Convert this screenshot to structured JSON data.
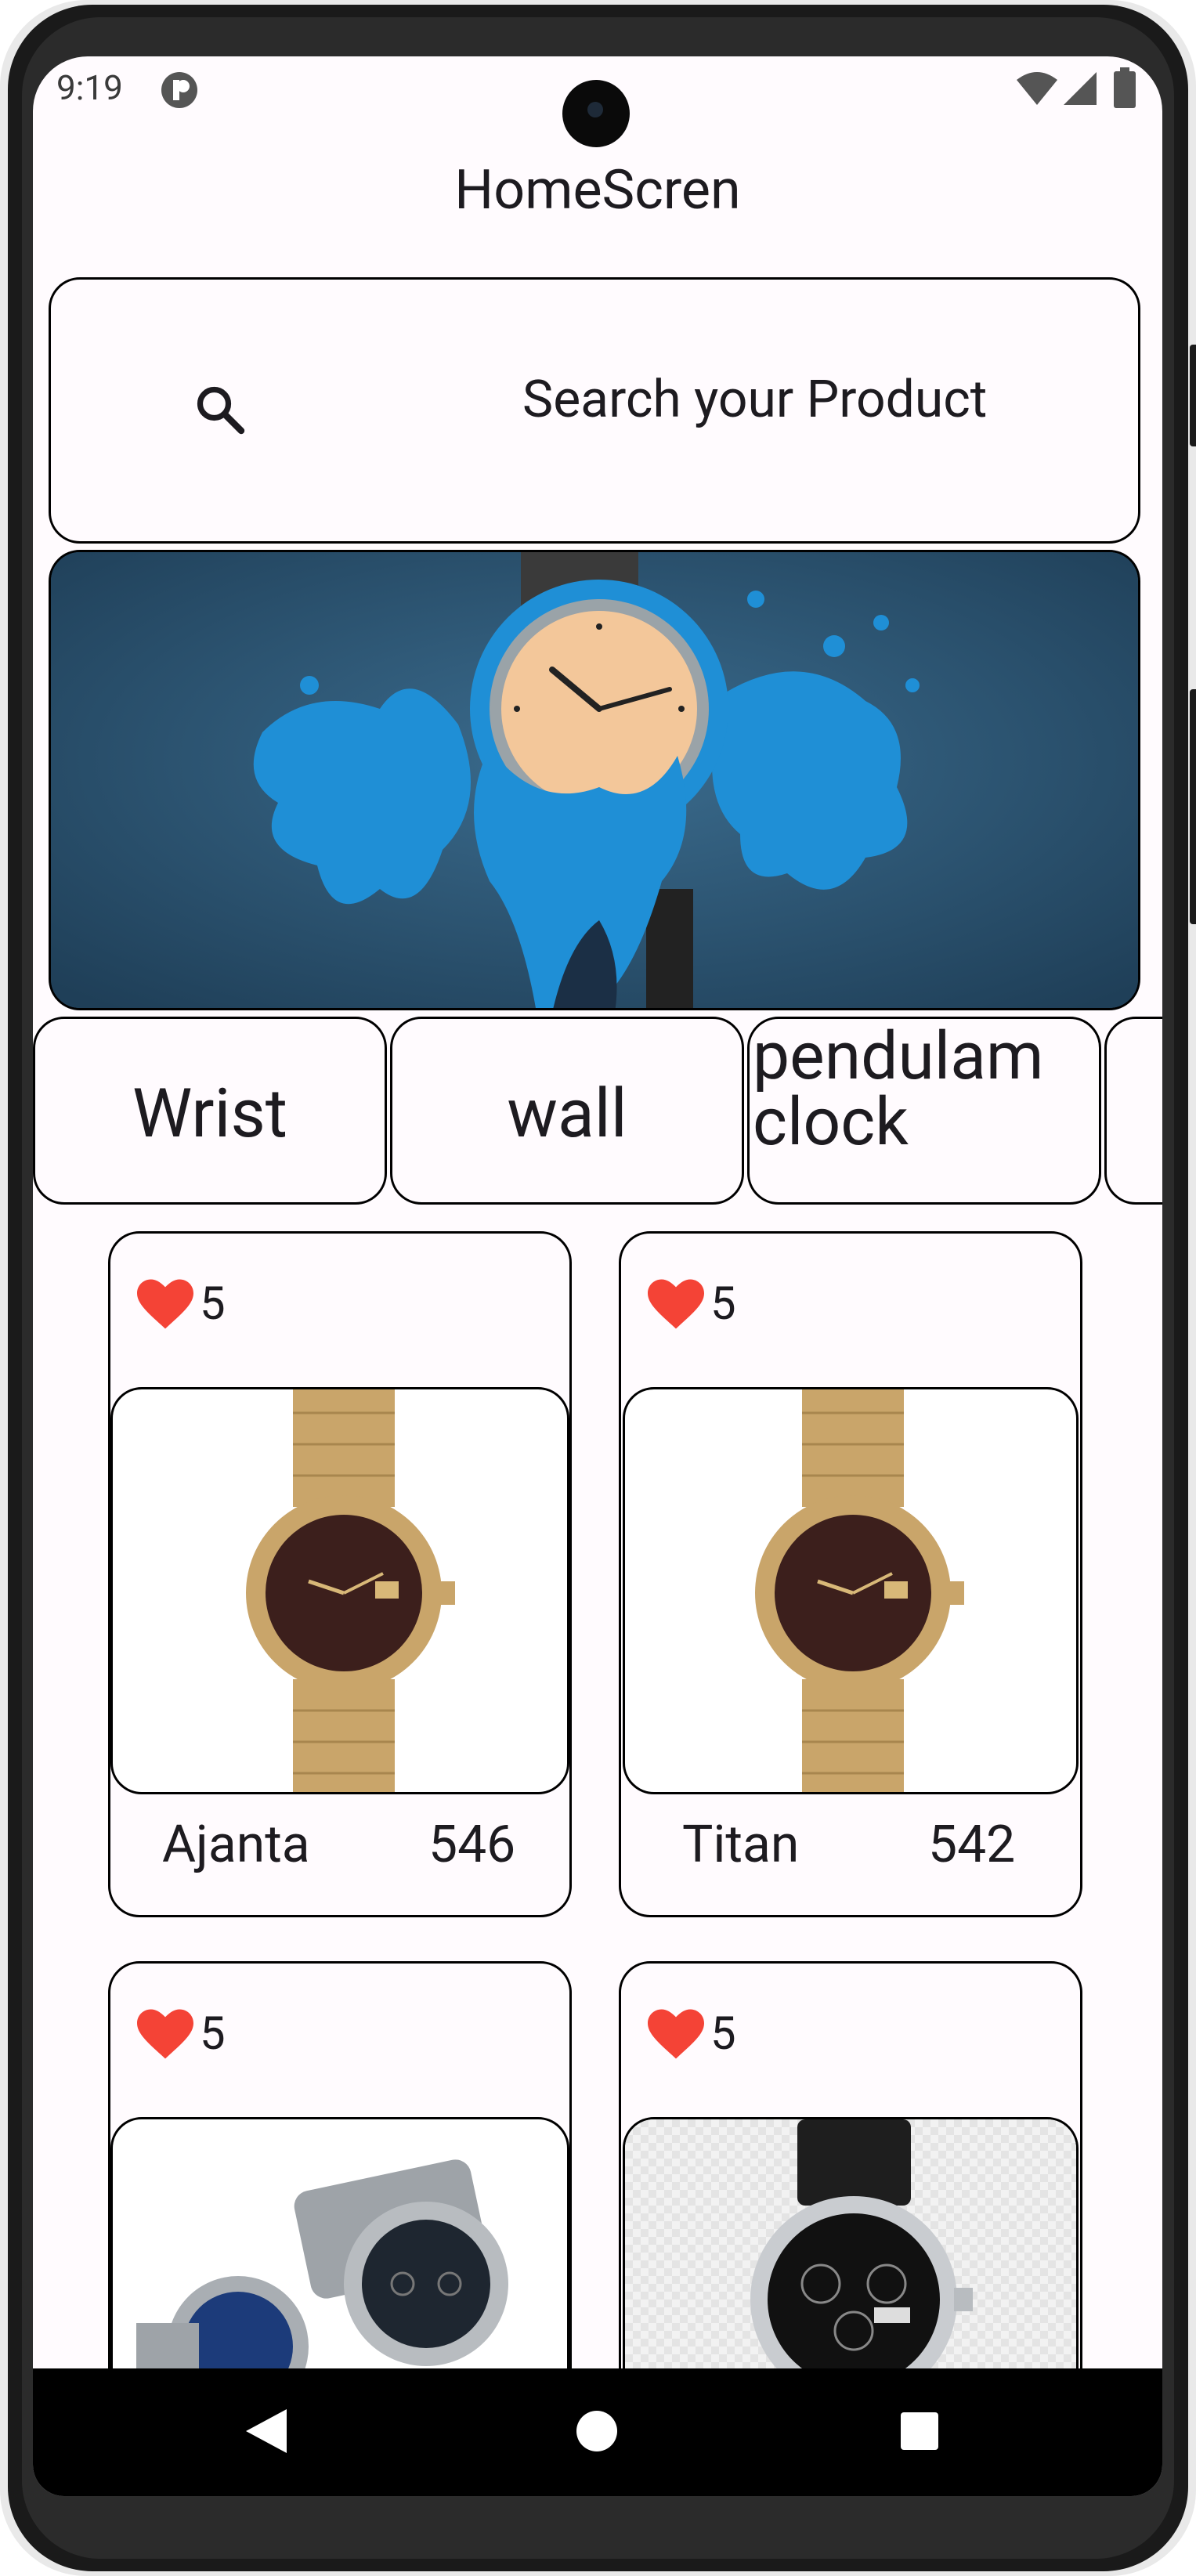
{
  "status_bar": {
    "time": "9:19"
  },
  "app": {
    "title": "HomeScren"
  },
  "search": {
    "placeholder": "Search your Product"
  },
  "categories": [
    {
      "label": "Wrist"
    },
    {
      "label": "wall"
    },
    {
      "label": "pendulam clock",
      "line1": "pendulam",
      "line2": "clock"
    }
  ],
  "products": [
    {
      "likes": "5",
      "name": "Ajanta",
      "price": "546"
    },
    {
      "likes": "5",
      "name": "Titan",
      "price": "542"
    },
    {
      "likes": "5",
      "name": "",
      "price": ""
    },
    {
      "likes": "5",
      "name": "",
      "price": ""
    }
  ],
  "colors": {
    "heart": "#f44336",
    "background": "#fffbfe",
    "banner_bg": "#2f5876"
  },
  "icons": {
    "search": "search-icon",
    "like": "heart-icon",
    "back": "back-icon",
    "home": "home-icon",
    "recents": "recents-icon"
  }
}
